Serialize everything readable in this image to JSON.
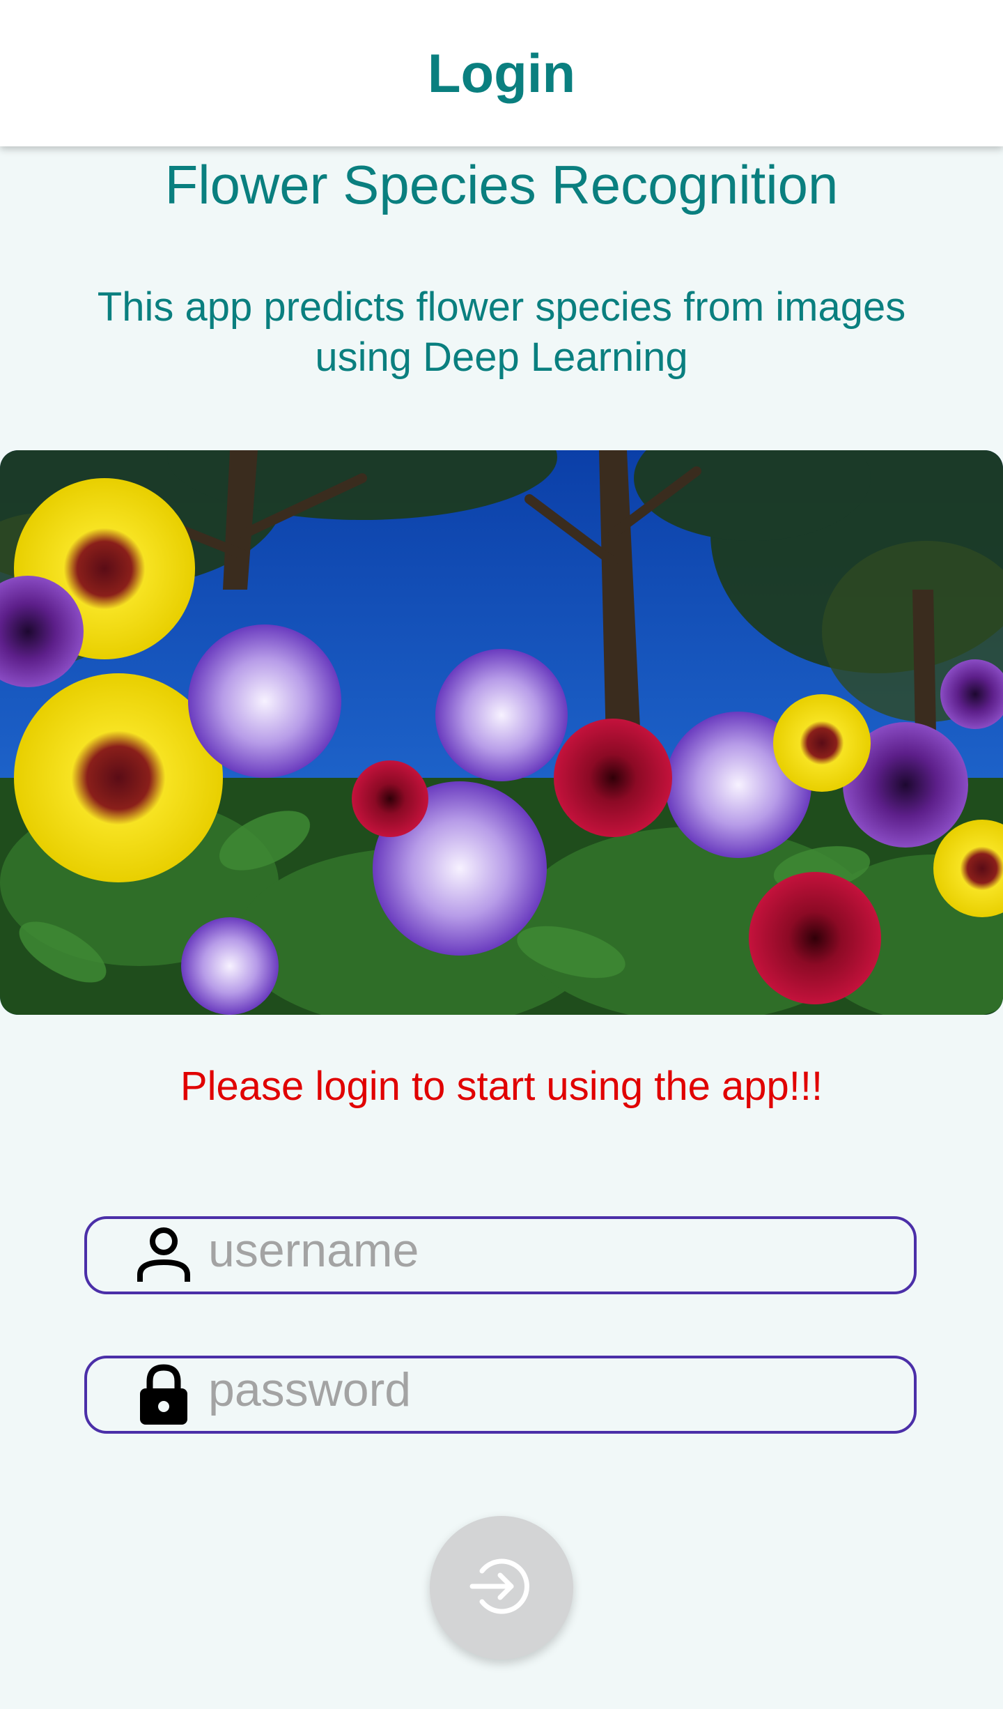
{
  "appbar": {
    "title": "Login"
  },
  "main": {
    "heading": "Flower Species Recognition",
    "subtitle": "This app predicts flower species from images using Deep Learning",
    "warning": "Please login to start using the app!!!"
  },
  "form": {
    "username": {
      "placeholder": "username",
      "value": "",
      "icon": "person-icon"
    },
    "password": {
      "placeholder": "password",
      "value": "",
      "icon": "lock-icon"
    },
    "submit_icon": "login-icon"
  },
  "colors": {
    "accent": "#0a7f7f",
    "warning": "#e00000",
    "field_border": "#4b2fa8",
    "background": "#f1f8f8",
    "button": "#d3d4d5"
  }
}
